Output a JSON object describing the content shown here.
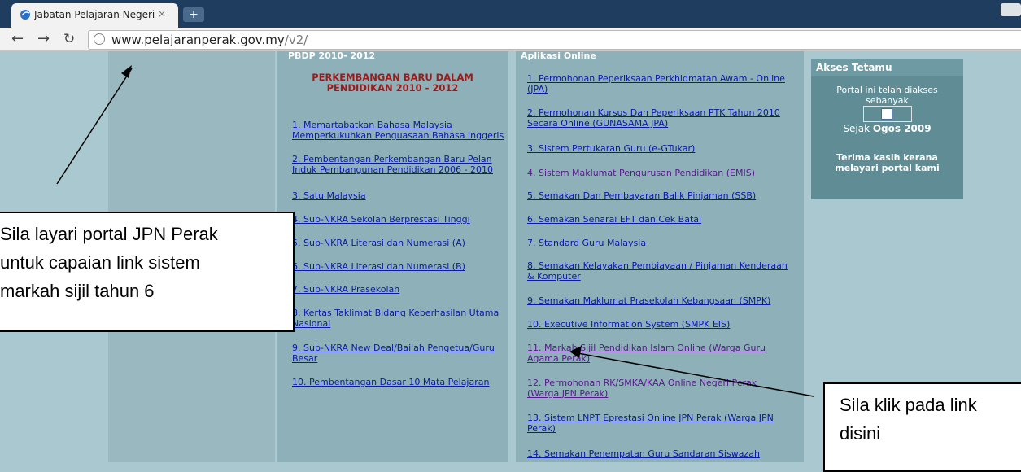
{
  "browser": {
    "tab_title": "Jabatan Pelajaran Negeri Pe",
    "tab_close": "×",
    "new_tab": "+",
    "url_domain": "www.pelajaranperak.gov.my",
    "url_path": "/v2/"
  },
  "column1": {
    "header": "PBDP 2010- 2012",
    "heading_line1": "PERKEMBANGAN BARU DALAM",
    "heading_line2": "PENDIDIKAN 2010 - 2012",
    "links": [
      {
        "l1": "1. Memartabatkan Bahasa Malaysia",
        "l2": "Memperkukuhkan Penguasaan Bahasa Inggeris"
      },
      {
        "l1": "2. Pembentangan Perkembangan Baru Pelan",
        "l2": "Induk Pembangunan Pendidikan 2006 - 2010"
      },
      {
        "l1": "3. Satu Malaysia",
        "l2": ""
      },
      {
        "l1": "4. Sub-NKRA Sekolah Berprestasi Tinggi",
        "l2": ""
      },
      {
        "l1": "5. Sub-NKRA Literasi dan Numerasi (A)",
        "l2": ""
      },
      {
        "l1": "6. Sub-NKRA Literasi dan Numerasi (B)",
        "l2": ""
      },
      {
        "l1": "7. Sub-NKRA Prasekolah",
        "l2": ""
      },
      {
        "l1": "8. Kertas Taklimat Bidang Keberhasilan Utama",
        "l2": "Nasional"
      },
      {
        "l1": "9. Sub-NKRA New Deal/Bai'ah Pengetua/Guru",
        "l2": "Besar"
      },
      {
        "l1": "10. Pembentangan Dasar 10 Mata Pelajaran",
        "l2": ""
      }
    ]
  },
  "column2": {
    "header": "Aplikasi Online",
    "links": [
      {
        "l1": "1. Permohonan Peperiksaan Perkhidmatan Awam - Online",
        "l2": "(JPA)"
      },
      {
        "l1": "2. Permohonan Kursus Dan Peperiksaan PTK Tahun 2010",
        "l2": "Secara Online (GUNASAMA JPA)"
      },
      {
        "l1": "3. Sistem Pertukaran Guru (e-GTukar)",
        "l2": ""
      },
      {
        "l1": "4. Sistem Maklumat Pengurusan Pendidikan (EMIS)",
        "l2": ""
      },
      {
        "l1": "5. Semakan Dan Pembayaran Balik Pinjaman (SSB)",
        "l2": ""
      },
      {
        "l1": "6. Semakan Senarai EFT dan Cek Batal",
        "l2": ""
      },
      {
        "l1": "7. Standard Guru Malaysia",
        "l2": ""
      },
      {
        "l1": "8. Semakan Kelayakan Pembiayaan / Pinjaman Kenderaan",
        "l2": "& Komputer"
      },
      {
        "l1": "9. Semakan Maklumat Prasekolah Kebangsaan (SMPK)",
        "l2": ""
      },
      {
        "l1": "10. Executive Information System (SMPK EIS)",
        "l2": ""
      },
      {
        "l1": "11. Markah Sijil Pendidikan Islam Online (Warga Guru",
        "l2": "Agama Perak)"
      },
      {
        "l1": "12. Permohonan RK/SMKA/KAA Online Negeri Perak",
        "l2": "(Warga JPN Perak)"
      },
      {
        "l1": "13. Sistem LNPT Eprestasi Online JPN Perak (Warga JPN",
        "l2": "Perak)"
      },
      {
        "l1": "14. Semakan Penempatan Guru Sandaran Siswazah",
        "l2": ""
      }
    ]
  },
  "access": {
    "header": "Akses Tetamu",
    "line1": "Portal ini telah diakses",
    "line2": "sebanyak",
    "since_prefix": "Sejak",
    "since_value": "Ogos 2009",
    "thanks1": "Terima kasih kerana",
    "thanks2": "melayari portal kami"
  },
  "callouts": {
    "left": [
      "Sila layari portal JPN Perak",
      "untuk capaian link sistem",
      "markah sijil tahun 6"
    ],
    "right": [
      "Sila klik pada link",
      "disini"
    ]
  }
}
